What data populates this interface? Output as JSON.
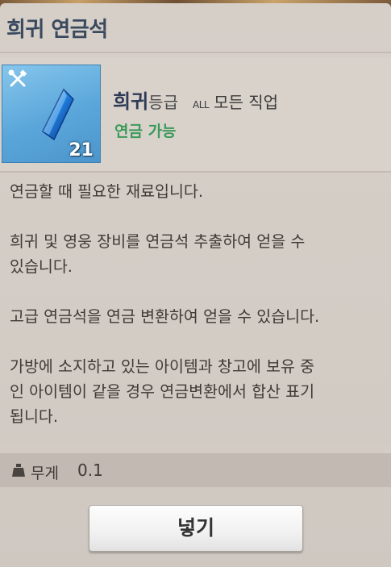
{
  "window": {
    "title": "희귀 연금석"
  },
  "item": {
    "count": "21",
    "icon": "blue-crystal-icon",
    "tool_icon": "crossed-tools-icon",
    "grade": "희귀",
    "grade_suffix": "등급",
    "class_badge": "ALL",
    "class_text": "모든 직업",
    "alchemy_status": "연금 가능"
  },
  "description": {
    "lines": [
      "연금할 때 필요한 재료입니다.",
      "",
      "희귀 및 영웅 장비를 연금석 추출하여 얻을 수",
      "있습니다.",
      "",
      "고급 연금석을 연금 변환하여 얻을 수 있습니다.",
      "",
      "가방에 소지하고 있는 아이템과 창고에 보유 중",
      "인 아이템이 같을 경우 연금변환에서 합산 표기",
      "됩니다."
    ]
  },
  "weight": {
    "label": "무게",
    "value": "0.1",
    "icon": "weight-icon"
  },
  "actions": {
    "put_label": "넣기"
  },
  "colors": {
    "grade": "#2e3b57",
    "alchemy": "#3c9a5a",
    "icon_bg": "#5aa6da"
  }
}
